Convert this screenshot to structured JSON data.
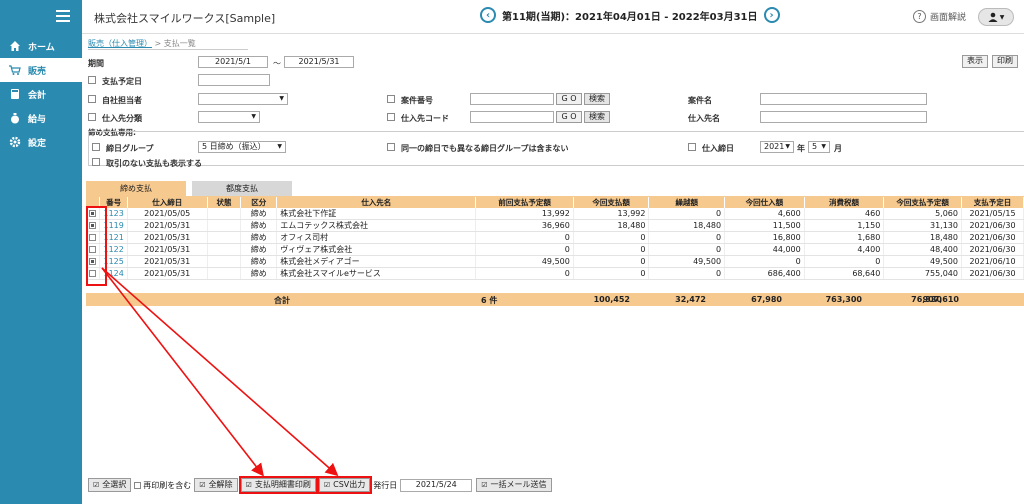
{
  "header": {
    "company": "株式会社スマイルワークス[Sample]",
    "period": "第11期(当期)：2021年04月01日 - 2022年03月31日",
    "help": "画面解説"
  },
  "sidebar": {
    "items": [
      {
        "label": "ホーム",
        "icon": "home-icon"
      },
      {
        "label": "販売",
        "icon": "cart-icon"
      },
      {
        "label": "会計",
        "icon": "calculator-icon"
      },
      {
        "label": "給与",
        "icon": "money-bag-icon"
      },
      {
        "label": "設定",
        "icon": "gear-icon"
      }
    ]
  },
  "breadcrumb": {
    "link": "販売（仕入管理）",
    "sep": ">",
    "current": "支払一覧"
  },
  "filters": {
    "period_label": "期間",
    "period_from": "2021/5/1",
    "period_to": "2021/5/31",
    "tilde": "〜",
    "display_btn": "表示",
    "print_btn": "印刷",
    "due_date_label": "支払予定日",
    "owner_label": "自社担当者",
    "supplier_class_label": "仕入先分類",
    "case_no_label": "案件番号",
    "supplier_code_label": "仕入先コード",
    "go": "G O",
    "search": "検索",
    "case_name_label": "案件名",
    "supplier_name_label": "仕入先名",
    "closing_section": "締め支払専用:",
    "closing_group_label": "締日グループ",
    "closing_group_value": "5 日締め（振込）",
    "same_closing_label": "同一の締日でも異なる締日グループは含まない",
    "closing_date_label": "仕入締日",
    "closing_year": "2021",
    "year_unit": "年",
    "closing_month": "5",
    "month_unit": "月",
    "no_txn_label": "取引のない支払も表示する"
  },
  "tabs": [
    {
      "label": "締め支払"
    },
    {
      "label": "都度支払"
    }
  ],
  "table": {
    "columns": [
      "番号",
      "仕入締日",
      "状態",
      "区分",
      "仕入先名",
      "前回支払予定額",
      "今回支払額",
      "繰越額",
      "今回仕入額",
      "消費税額",
      "今回支払予定額",
      "支払予定日"
    ],
    "rows": [
      {
        "checked": true,
        "no": "1123",
        "date": "2021/05/05",
        "status": "",
        "kind": "締め",
        "name": "株式会社下作証",
        "prev": "13,992",
        "paid": "13,992",
        "carry": "0",
        "purchase": "4,600",
        "tax": "460",
        "due_amount": "5,060",
        "due_date": "2021/05/15"
      },
      {
        "checked": true,
        "no": "1119",
        "date": "2021/05/31",
        "status": "",
        "kind": "締め",
        "name": "エムコテックス株式会社",
        "prev": "36,960",
        "paid": "18,480",
        "carry": "18,480",
        "purchase": "11,500",
        "tax": "1,150",
        "due_amount": "31,130",
        "due_date": "2021/06/30"
      },
      {
        "checked": false,
        "no": "1121",
        "date": "2021/05/31",
        "status": "",
        "kind": "締め",
        "name": "オフィス司村",
        "prev": "0",
        "paid": "0",
        "carry": "0",
        "purchase": "16,800",
        "tax": "1,680",
        "due_amount": "18,480",
        "due_date": "2021/06/30"
      },
      {
        "checked": false,
        "no": "1122",
        "date": "2021/05/31",
        "status": "",
        "kind": "締め",
        "name": "ヴィヴェア株式会社",
        "prev": "0",
        "paid": "0",
        "carry": "0",
        "purchase": "44,000",
        "tax": "4,400",
        "due_amount": "48,400",
        "due_date": "2021/06/30"
      },
      {
        "checked": true,
        "no": "1125",
        "date": "2021/05/31",
        "status": "",
        "kind": "締め",
        "name": "株式会社メディアゴー",
        "prev": "49,500",
        "paid": "0",
        "carry": "49,500",
        "purchase": "0",
        "tax": "0",
        "due_amount": "49,500",
        "due_date": "2021/06/10"
      },
      {
        "checked": false,
        "no": "1124",
        "date": "2021/05/31",
        "status": "",
        "kind": "締め",
        "name": "株式会社スマイルeサービス",
        "prev": "0",
        "paid": "0",
        "carry": "0",
        "purchase": "686,400",
        "tax": "68,640",
        "due_amount": "755,040",
        "due_date": "2021/06/30"
      }
    ],
    "total": {
      "label": "合計",
      "count": "6 件",
      "prev": "100,452",
      "paid": "32,472",
      "carry": "67,980",
      "purchase": "763,300",
      "tax": "76,330",
      "due_amount": "907,610"
    }
  },
  "bottom": {
    "select_all": "全選択",
    "reprint": "再印刷を含む",
    "deselect": "全解除",
    "print_detail": "支払明細書印刷",
    "csv": "CSV出力",
    "issue_date_label": "発行日",
    "issue_date": "2021/5/24",
    "mail": "一括メール送信"
  },
  "colors": {
    "accent": "#2a8ab0",
    "table_header": "#f6c98e",
    "highlight": "#e11111"
  }
}
